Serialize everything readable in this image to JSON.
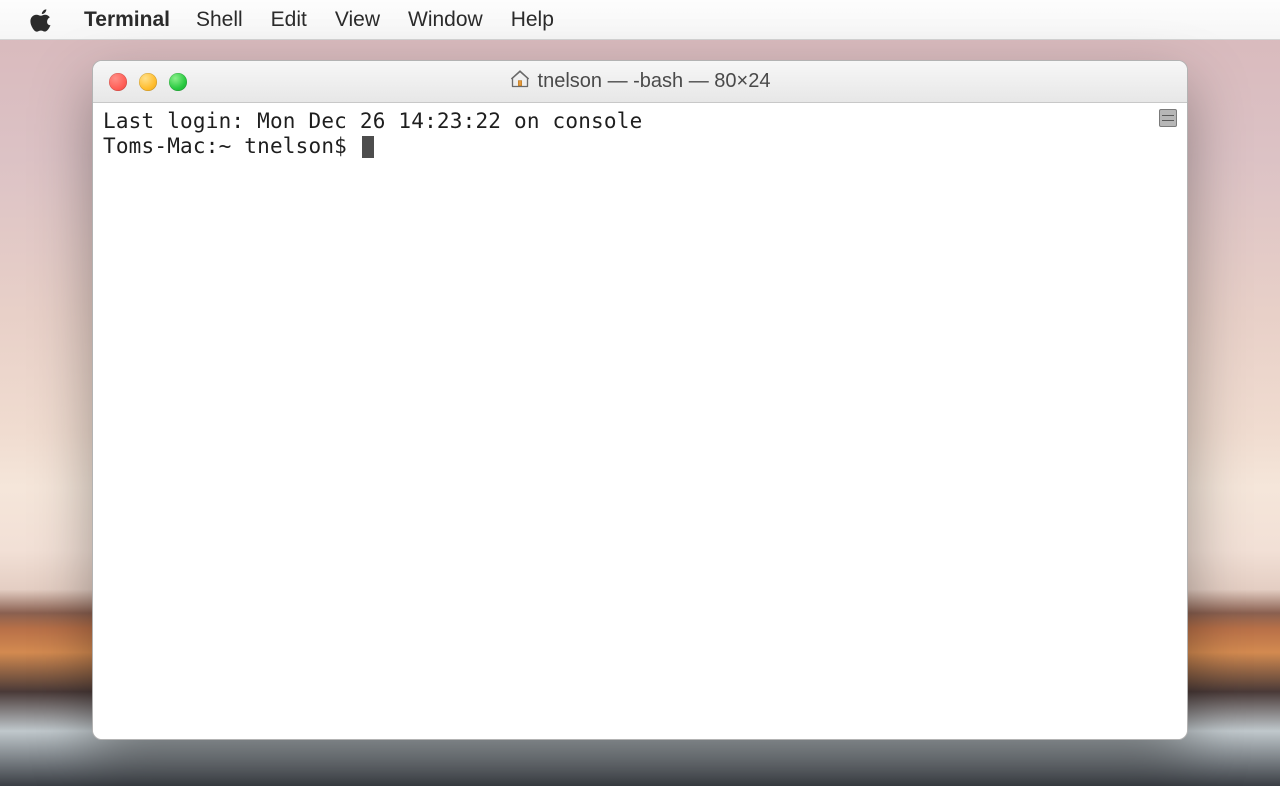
{
  "menubar": {
    "app_name": "Terminal",
    "items": [
      "Shell",
      "Edit",
      "View",
      "Window",
      "Help"
    ]
  },
  "window": {
    "title": "tnelson — -bash — 80×24",
    "traffic_light_colors": {
      "close": "#ff5f57",
      "minimize": "#ffbd2e",
      "zoom": "#28c940"
    }
  },
  "terminal": {
    "lines": [
      "Last login: Mon Dec 26 14:23:22 on console",
      "Toms-Mac:~ tnelson$ "
    ],
    "prompt_cursor": true
  }
}
